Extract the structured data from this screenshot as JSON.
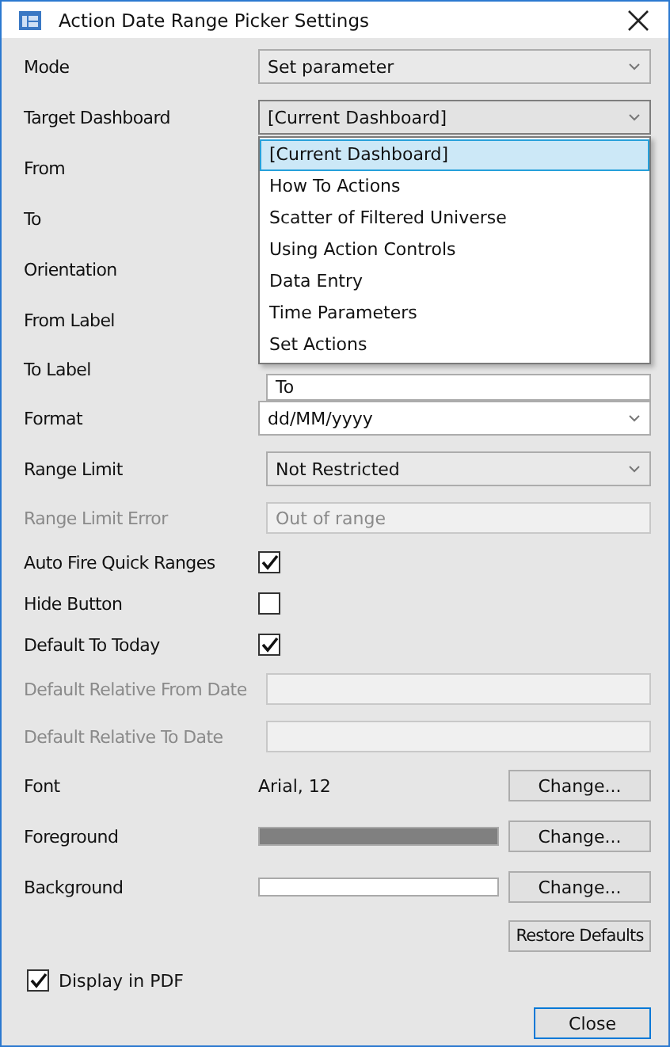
{
  "window": {
    "title": "Action Date Range Picker Settings"
  },
  "rows": [
    {
      "kind": "combo",
      "label": "Mode",
      "value": "Set parameter",
      "editable": false,
      "disabled": false
    },
    {
      "kind": "combo",
      "label": "Target Dashboard",
      "value": "[Current Dashboard]",
      "editable": false,
      "disabled": false,
      "expanded": true,
      "options": [
        {
          "label": "[Current Dashboard]",
          "selected": true
        },
        {
          "label": "How To Actions",
          "selected": false
        },
        {
          "label": "Scatter of Filtered Universe",
          "selected": false
        },
        {
          "label": "Using Action Controls",
          "selected": false
        },
        {
          "label": "Data Entry",
          "selected": false
        },
        {
          "label": "Time Parameters",
          "selected": false
        },
        {
          "label": "Set Actions",
          "selected": false
        }
      ]
    },
    {
      "kind": "label",
      "label": "From",
      "disabled": false
    },
    {
      "kind": "label",
      "label": "To",
      "disabled": false
    },
    {
      "kind": "label",
      "label": "Orientation",
      "disabled": false
    },
    {
      "kind": "label",
      "label": "From Label",
      "disabled": false
    },
    {
      "kind": "text",
      "label": "To Label",
      "value": "To",
      "disabled": false
    },
    {
      "kind": "combo",
      "label": "Format",
      "value": "dd/MM/yyyy",
      "editable": true,
      "disabled": false
    },
    {
      "kind": "combo",
      "label": "Range Limit",
      "value": "Not Restricted",
      "editable": false,
      "disabled": false
    },
    {
      "kind": "text",
      "label": "Range Limit Error",
      "value": "Out of range",
      "disabled": true
    },
    {
      "kind": "checkbox",
      "label": "Auto Fire Quick Ranges",
      "checked": true,
      "disabled": false
    },
    {
      "kind": "checkbox",
      "label": "Hide Button",
      "checked": false,
      "disabled": false
    },
    {
      "kind": "checkbox",
      "label": "Default To Today",
      "checked": true,
      "disabled": false
    },
    {
      "kind": "text",
      "label": "Default Relative From Date",
      "disabled": true
    },
    {
      "kind": "text",
      "label": "Default Relative To Date",
      "disabled": true
    },
    {
      "kind": "font",
      "label": "Font",
      "value": "Arial, 12",
      "button": "Change...",
      "disabled": false
    },
    {
      "kind": "color",
      "label": "Foreground",
      "color": "#808080",
      "button": "Change...",
      "disabled": false
    },
    {
      "kind": "color",
      "label": "Background",
      "color": "#ffffff",
      "button": "Change...",
      "disabled": false
    }
  ],
  "restore_button": "Restore Defaults",
  "display_in_pdf": {
    "label": "Display in PDF",
    "checked": true
  },
  "close_button": "Close"
}
